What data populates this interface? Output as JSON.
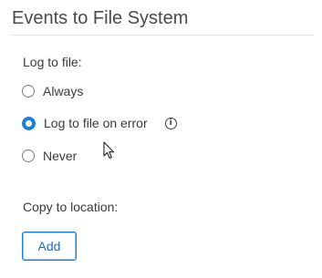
{
  "section": {
    "title": "Events to File System"
  },
  "log_to_file": {
    "label": "Log to file:",
    "options": [
      {
        "label": "Always",
        "selected": false
      },
      {
        "label": "Log to file on error",
        "selected": true,
        "info_icon": "info-icon"
      },
      {
        "label": "Never",
        "selected": false
      }
    ]
  },
  "copy_to_location": {
    "label": "Copy to location:",
    "add_button_label": "Add"
  },
  "colors": {
    "accent": "#1f7fd1",
    "text": "#3a3a3a",
    "radio_border": "#7d7d7d",
    "rule": "#e3e3e3"
  }
}
